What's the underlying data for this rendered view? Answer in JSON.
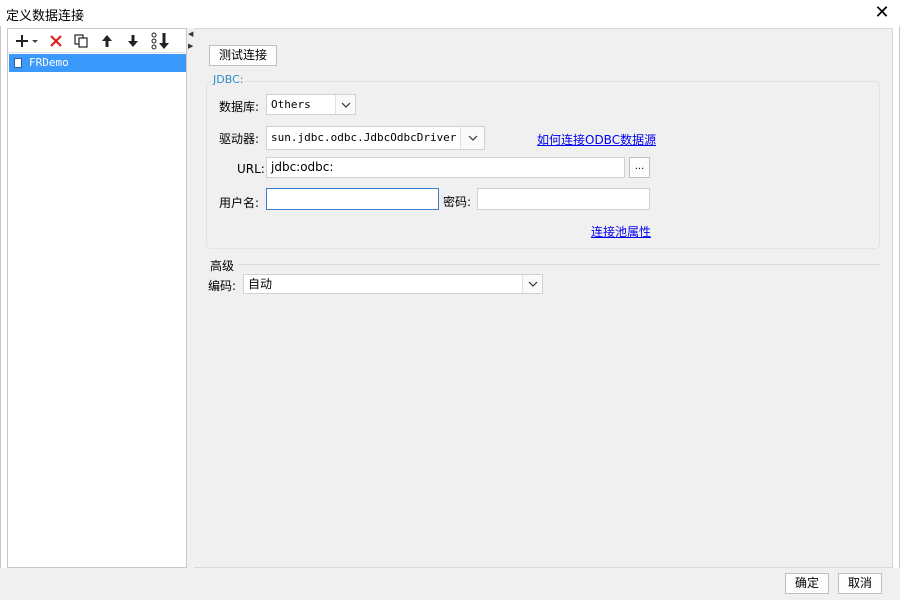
{
  "window": {
    "title": "定义数据连接",
    "close_glyph": "✕"
  },
  "toolbar": {
    "icons": [
      "add-dropdown-icon",
      "delete-icon",
      "copy-icon",
      "move-up-icon",
      "move-down-icon",
      "sort-icon"
    ]
  },
  "tree": {
    "items": [
      {
        "label": "FRDemo",
        "selected": true
      }
    ]
  },
  "main": {
    "test_button": "测试连接",
    "jdbc_legend": "JDBC:",
    "database": {
      "label": "数据库:",
      "value": "Others"
    },
    "driver": {
      "label": "驱动器:",
      "value": "sun.jdbc.odbc.JdbcOdbcDriver",
      "help_link": "如何连接ODBC数据源"
    },
    "url": {
      "label": "URL:",
      "value": "jdbc:odbc:",
      "browse": "..."
    },
    "username": {
      "label": "用户名:",
      "value": ""
    },
    "password": {
      "label": "密码:",
      "value": ""
    },
    "pool_link": "连接池属性",
    "advanced": {
      "title": "高级",
      "encoding_label": "编码:",
      "encoding_value": "自动"
    }
  },
  "footer": {
    "ok": "确定",
    "cancel": "取消"
  },
  "colors": {
    "selection": "#3b99fc",
    "link": "#0000ee",
    "legend": "#2a8fc7",
    "delete": "#e02020"
  }
}
